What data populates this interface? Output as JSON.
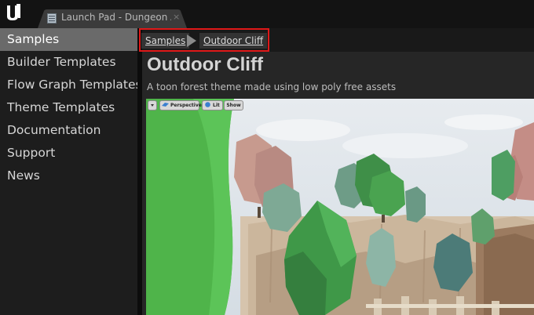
{
  "window": {
    "tab_title": "Launch Pad - Dungeon A",
    "tab_close": "×",
    "logo_icon": "unreal-engine-logo",
    "tab_icon": "document-list-icon"
  },
  "sidebar": {
    "items": [
      {
        "label": "Samples",
        "active": true
      },
      {
        "label": "Builder Templates",
        "active": false
      },
      {
        "label": "Flow Graph Templates",
        "active": false
      },
      {
        "label": "Theme Templates",
        "active": false
      },
      {
        "label": "Documentation",
        "active": false
      },
      {
        "label": "Support",
        "active": false
      },
      {
        "label": "News",
        "active": false
      }
    ]
  },
  "breadcrumb": {
    "items": [
      "Samples",
      "Outdoor Cliff"
    ],
    "highlight_color": "#e01818"
  },
  "main": {
    "title": "Outdoor Cliff",
    "subtitle": "A toon forest theme made using low poly free assets"
  },
  "viewport": {
    "toolbar": {
      "perspective_label": "Perspective",
      "lit_label": "Lit",
      "show_label": "Show"
    }
  },
  "colors": {
    "active_nav": "#6a6a6a",
    "sidebar_bg": "#1d1d1d",
    "content_bg": "#262626"
  }
}
